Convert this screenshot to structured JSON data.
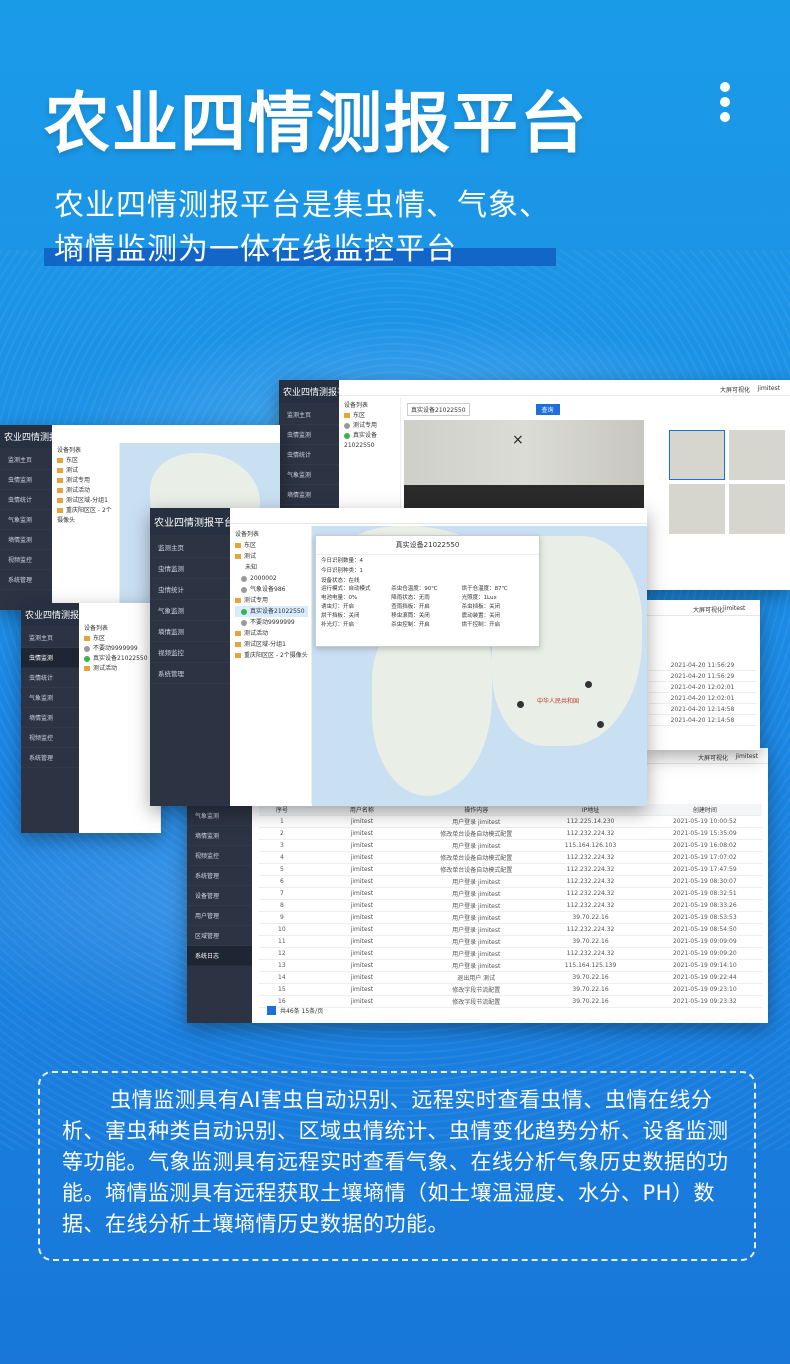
{
  "title": "农业四情测报平台",
  "subtitle": {
    "line1": "农业四情测报平台是集虫情、气象、",
    "line2": "墒情监测为一体在线监控平台"
  },
  "description": "虫情监测具有AI害虫自动识别、远程实时查看虫情、虫情在线分析、害虫种类自动识别、区域虫情统计、虫情变化趋势分析、设备监测等功能。气象监测具有远程实时查看气象、在线分析气象历史数据的功能。墒情监测具有远程获取土壤墒情（如土壤温湿度、水分、PH）数据、在线分析土壤墒情历史数据的功能。",
  "screens": {
    "brand": "农业四情测报平台",
    "nav": [
      "监测主页",
      "虫情监测",
      "虫情统计",
      "气象监测",
      "墒情监测",
      "视频监控",
      "系统管理"
    ],
    "tree_header": "设备列表",
    "tree": {
      "region": "东区",
      "test": "测试",
      "unknown": "未知",
      "device_2000002": "2000002",
      "weather_device": "气象设备986",
      "test_use": "测试专用",
      "real_device": "真实设备21022550",
      "not_dev": "不要动9999999",
      "test_activity": "测试活动",
      "test_zone": "测试区域-分组1",
      "camera_zone": "重庆阳区区 - 2个摄像头"
    },
    "popup": {
      "title": "真实设备21022550",
      "today_count": "今日识别数量：4",
      "today_kinds": "今日识别种类：1",
      "status": "设备状态：在线",
      "fields": [
        "运行模式：自动模式",
        "杀虫仓温度：90℃",
        "烘干仓温度：87℃",
        "电池电量：0%",
        "降雨状态：无雨",
        "光照度：1Lux",
        "诱虫灯：开启",
        "查雨挡板：开启",
        "杀虫挡板：关闭",
        "烘干挡板：关闭",
        "移虫滚筒：关闭",
        "震动装置：关闭",
        "补光灯：开启",
        "杀虫控制：开启",
        "烘干控制：开启"
      ]
    },
    "map_label": "中华人民共和国",
    "table_headers": [
      "序号",
      "用户名称",
      "操作内容",
      "IP地址",
      "创建时间"
    ],
    "table_rows": [
      [
        "1",
        "jimitest",
        "用户登录 jimitest",
        "112.225.14.230",
        "2021-05-19 10:00:52"
      ],
      [
        "2",
        "jimitest",
        "修改单台设备自动模式配置",
        "112.232.224.32",
        "2021-05-19 15:35:09"
      ],
      [
        "3",
        "jimitest",
        "用户登录 jimitest",
        "115.164.126.103",
        "2021-05-19 16:08:02"
      ],
      [
        "4",
        "jimitest",
        "修改单台设备自动模式配置",
        "112.232.224.32",
        "2021-05-19 17:07:02"
      ],
      [
        "5",
        "jimitest",
        "修改单台设备自动模式配置",
        "112.232.224.32",
        "2021-05-19 17:47:59"
      ],
      [
        "6",
        "jimitest",
        "用户登录 jimitest",
        "112.232.224.32",
        "2021-05-19 08:30:07"
      ],
      [
        "7",
        "jimitest",
        "用户登录 jimitest",
        "112.232.224.32",
        "2021-05-19 08:32:51"
      ],
      [
        "8",
        "jimitest",
        "用户登录 jimitest",
        "112.232.224.32",
        "2021-05-19 08:33:26"
      ],
      [
        "9",
        "jimitest",
        "用户登录 jimitest",
        "39.70.22.16",
        "2021-05-19 08:53:53"
      ],
      [
        "10",
        "jimitest",
        "用户登录 jimitest",
        "112.232.224.32",
        "2021-05-19 08:54:50"
      ],
      [
        "11",
        "jimitest",
        "用户登录 jimitest",
        "39.70.22.16",
        "2021-05-19 09:09:09"
      ],
      [
        "12",
        "jimitest",
        "用户登录 jimitest",
        "112.232.224.32",
        "2021-05-19 09:09:20"
      ],
      [
        "13",
        "jimitest",
        "用户登录 jimitest",
        "115.164.125.139",
        "2021-05-19 09:14:10"
      ],
      [
        "14",
        "jimitest",
        "退出用户 测试",
        "39.70.22.16",
        "2021-05-19 09:22:44"
      ],
      [
        "15",
        "jimitest",
        "修改字段节流配置",
        "39.70.22.16",
        "2021-05-19 09:23:10"
      ],
      [
        "16",
        "jimitest",
        "修改字段节流配置",
        "39.70.22.16",
        "2021-05-19 09:23:32"
      ]
    ],
    "pagination": "共46条 15条/页",
    "top_links": [
      "大屏可视化",
      "jimitest"
    ],
    "query_button": "查询",
    "device_name_label": "真实设备21022550",
    "sys_nav": [
      "设备管理",
      "用户管理",
      "区域管理",
      "系统日志"
    ]
  }
}
